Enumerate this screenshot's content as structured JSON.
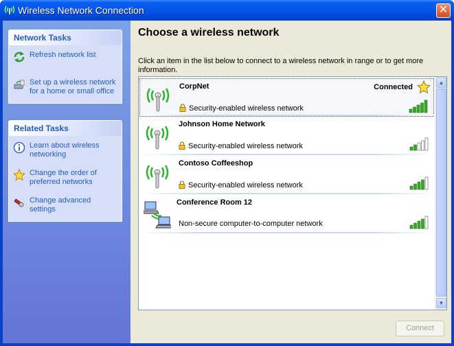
{
  "window": {
    "title": "Wireless Network Connection"
  },
  "sidebar": {
    "network_tasks": {
      "heading": "Network Tasks",
      "items": [
        {
          "label": "Refresh network list",
          "icon": "refresh-icon"
        },
        {
          "label": "Set up a wireless network for a home or small office",
          "icon": "setup-wireless-icon"
        }
      ]
    },
    "related_tasks": {
      "heading": "Related Tasks",
      "items": [
        {
          "label": "Learn about wireless networking",
          "icon": "info-icon"
        },
        {
          "label": "Change the order of preferred networks",
          "icon": "star-icon"
        },
        {
          "label": "Change advanced settings",
          "icon": "settings-icon"
        }
      ]
    }
  },
  "main": {
    "title": "Choose a wireless network",
    "description": "Click an item in the list below to connect to a wireless network in range or to get more information.",
    "connect_label": "Connect",
    "networks": [
      {
        "name": "CorpNet",
        "status": "Connected",
        "security": "Security-enabled wireless network",
        "signal_bars": 5,
        "secured": true,
        "type": "access-point"
      },
      {
        "name": "Johnson Home Network",
        "status": "",
        "security": "Security-enabled wireless network",
        "signal_bars": 2,
        "secured": true,
        "type": "access-point"
      },
      {
        "name": "Contoso Coffeeshop",
        "status": "",
        "security": "Security-enabled wireless network",
        "signal_bars": 4,
        "secured": true,
        "type": "access-point"
      },
      {
        "name": "Conference Room 12",
        "status": "",
        "security": "Non-secure computer-to-computer network",
        "signal_bars": 4,
        "secured": false,
        "type": "ad-hoc"
      }
    ]
  },
  "colors": {
    "titlebar": "#0455e6",
    "sidebar_link": "#215dc6",
    "signal_green": "#3ca82a"
  }
}
